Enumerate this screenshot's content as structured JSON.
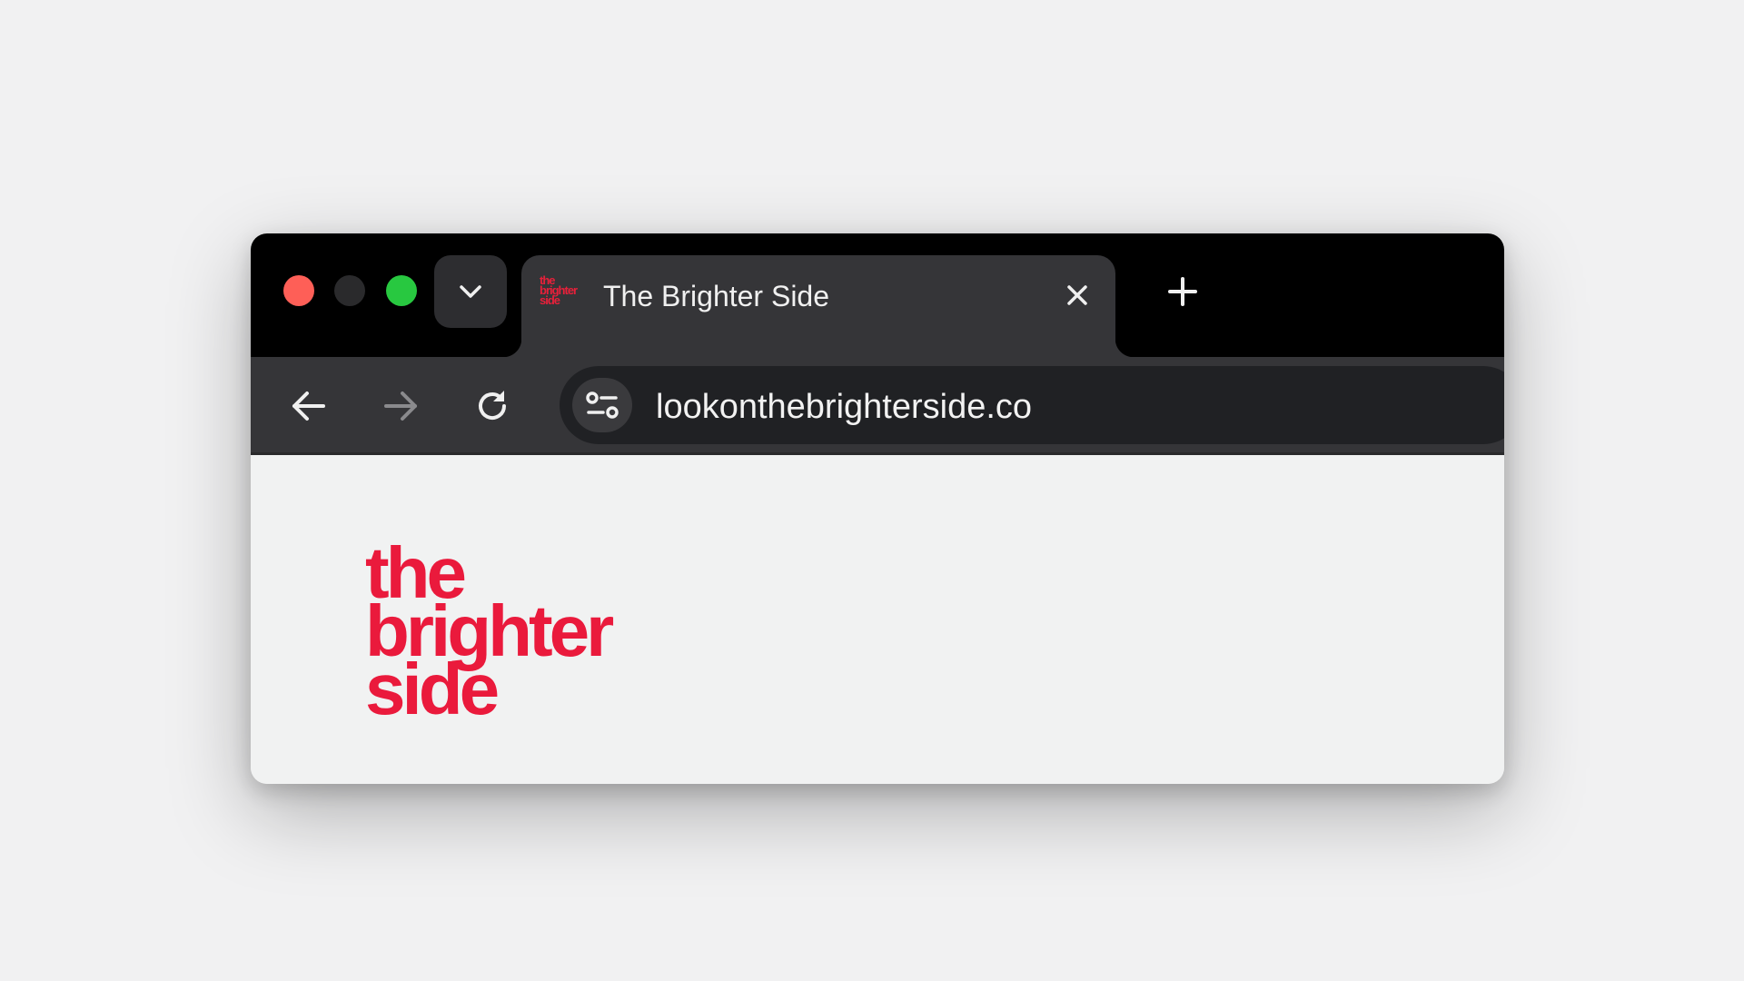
{
  "window": {
    "traffic_lights": {
      "close_color": "#fe5f57",
      "minimize_color": "#2a2a2c",
      "maximize_color": "#28c840"
    },
    "tab_search_icon": "chevron-down-icon",
    "new_tab_icon": "plus-icon"
  },
  "tab": {
    "title": "The Brighter Side",
    "favicon_lines": [
      "the",
      "brighter",
      "side"
    ],
    "close_icon": "close-icon"
  },
  "toolbar": {
    "back_icon": "arrow-left-icon",
    "forward_icon": "arrow-right-icon",
    "reload_icon": "reload-icon",
    "site_info_icon": "tune-icon",
    "url": "lookonthebrighterside.co"
  },
  "page": {
    "logo_lines": [
      "the",
      "brighter",
      "side"
    ],
    "brand_color": "#ea1a3c"
  }
}
